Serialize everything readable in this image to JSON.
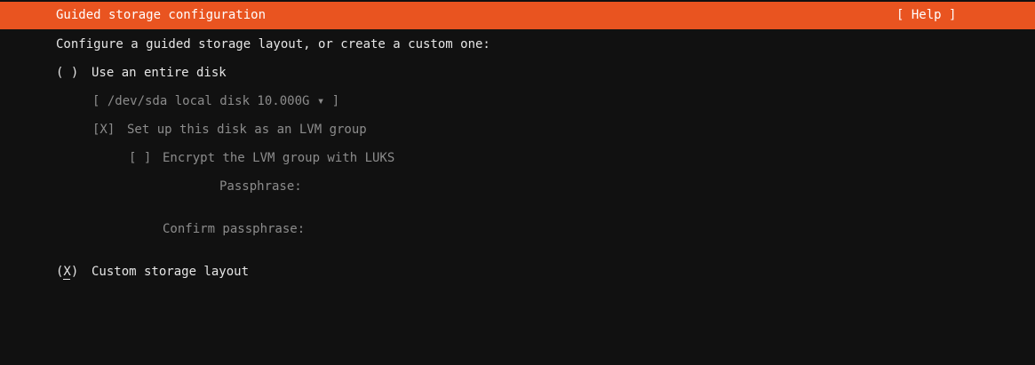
{
  "header": {
    "title": "Guided storage configuration",
    "help_label": "[ Help ]"
  },
  "main": {
    "intro": "Configure a guided storage layout, or create a custom one:",
    "entire_disk": {
      "radio": "( )",
      "label": "Use an entire disk",
      "disk_select": "[ /dev/sda local disk 10.000G ▾ ]",
      "lvm_checkbox": "[X]",
      "lvm_label": "Set up this disk as an LVM group",
      "encrypt_checkbox": "[ ]",
      "encrypt_label": "Encrypt the LVM group with LUKS",
      "passphrase_label": "Passphrase:",
      "confirm_label": "Confirm passphrase:"
    },
    "custom_layout": {
      "radio": "(X)",
      "label": "Custom storage layout"
    }
  },
  "colors": {
    "accent": "#e95420",
    "background": "#111111",
    "text": "#e6e6e6",
    "disabled_text": "#8c8c8c"
  }
}
